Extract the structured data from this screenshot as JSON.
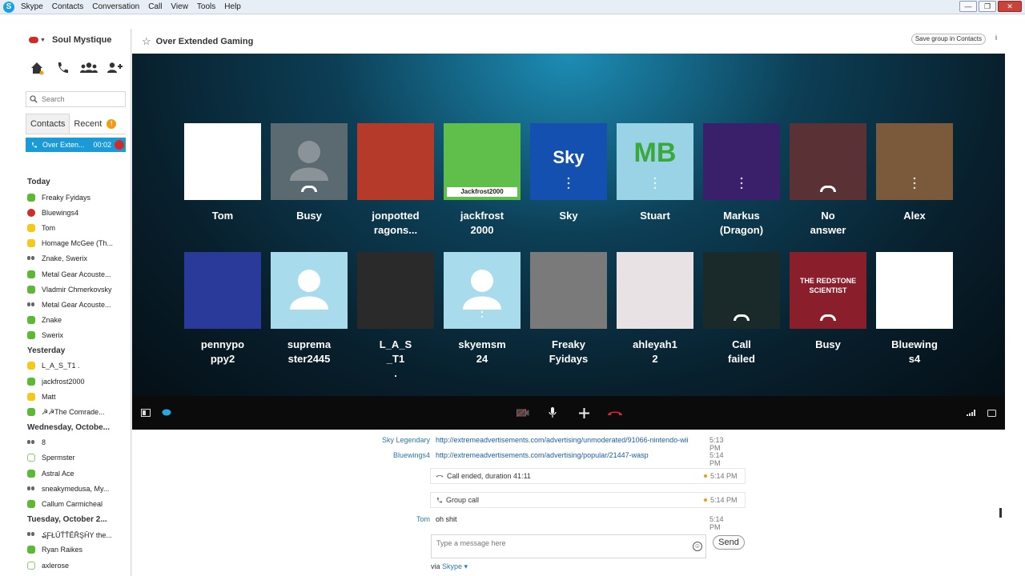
{
  "menu": {
    "items": [
      "Skype",
      "Contacts",
      "Conversation",
      "Call",
      "View",
      "Tools",
      "Help"
    ]
  },
  "window_controls": {
    "minimize": "—",
    "restore": "❐",
    "close": "✕"
  },
  "user": {
    "name": "Soul Mystique",
    "status_color": "#d22a2a"
  },
  "search": {
    "placeholder": "Search"
  },
  "tabs": {
    "contacts": "Contacts",
    "recent": "Recent",
    "recent_badge": "!"
  },
  "active_call": {
    "name": "Over Exten...",
    "time": "00:02"
  },
  "groups": [
    {
      "label": "Today",
      "contacts": [
        {
          "name": "Freaky Fyidays",
          "status": "online"
        },
        {
          "name": "Bluewings4",
          "status": "dnd"
        },
        {
          "name": "Tom",
          "status": "away"
        },
        {
          "name": "Homage McGee (Th...",
          "status": "away"
        },
        {
          "name": "Znake, Swerix",
          "status": "group"
        },
        {
          "name": "Metal Gear Acouste...",
          "status": "online"
        },
        {
          "name": "Vladmir Chmerkovsky",
          "status": "online"
        },
        {
          "name": "Metal Gear Acouste...",
          "status": "group"
        },
        {
          "name": "Znake",
          "status": "online"
        },
        {
          "name": "Swerix",
          "status": "online"
        }
      ]
    },
    {
      "label": "Yesterday",
      "contacts": [
        {
          "name": "L_A_S_T1 .",
          "status": "away"
        },
        {
          "name": "jackfrost2000",
          "status": "online"
        },
        {
          "name": "Matt",
          "status": "away"
        },
        {
          "name": "☭☭The Comrade...",
          "status": "online"
        }
      ]
    },
    {
      "label": "Wednesday, Octobe...",
      "contacts": [
        {
          "name": "8",
          "status": "group"
        },
        {
          "name": "Spermster",
          "status": "offline"
        },
        {
          "name": "Astral Ace",
          "status": "online"
        },
        {
          "name": "sneakymedusa, My...",
          "status": "group"
        },
        {
          "name": "Callum Carmicheal",
          "status": "online"
        }
      ]
    },
    {
      "label": "Tuesday, October 2...",
      "contacts": [
        {
          "name": "₷ƑŁŰŤŤĔŘŞĤY the...",
          "status": "group"
        },
        {
          "name": "Ryan Raikes",
          "status": "online"
        },
        {
          "name": "axlerose",
          "status": "offline"
        }
      ]
    }
  ],
  "conversation": {
    "title": "Over Extended Gaming",
    "save_group": "Save group in Contacts",
    "info": "i"
  },
  "participants": [
    {
      "label": "Tom",
      "bg": "#ffffff",
      "state": "dots"
    },
    {
      "label": "Busy",
      "bg": "#5a6a70",
      "state": "ended",
      "avatar": "generic-dark"
    },
    {
      "label": "jonpotted ragons...",
      "bg": "#b53a2a",
      "state": "none"
    },
    {
      "label": "jackfrost 2000",
      "bg": "#5fbf4a",
      "state": "none",
      "caption": "Jackfrost2000"
    },
    {
      "label": "Sky",
      "bg": "#1450b0",
      "state": "dots",
      "caption": "Sky"
    },
    {
      "label": "Stuart",
      "bg": "#9ad3e6",
      "state": "dots",
      "caption": "MB"
    },
    {
      "label": "Markus (Dragon)",
      "bg": "#3a1f6a",
      "state": "dots"
    },
    {
      "label": "No answer",
      "bg": "#5a3236",
      "state": "ended"
    },
    {
      "label": "Alex",
      "bg": "#7a5a3a",
      "state": "dots"
    },
    {
      "label": "pennypo ppy2",
      "bg": "#2a3a9a",
      "state": "none"
    },
    {
      "label": "suprema ster2445",
      "bg": "#a8dcec",
      "state": "none",
      "avatar": "generic-light"
    },
    {
      "label": "L_A_S _T1 .",
      "bg": "#2a2a2a",
      "state": "none"
    },
    {
      "label": "skyemsm 24",
      "bg": "#a8dcec",
      "state": "dots",
      "avatar": "generic-light"
    },
    {
      "label": "Freaky Fyidays",
      "bg": "#7a7a7a",
      "state": "none"
    },
    {
      "label": "ahleyah1 2",
      "bg": "#e8e2e4",
      "state": "none"
    },
    {
      "label": "Call failed",
      "bg": "#1a2a2a",
      "state": "ended"
    },
    {
      "label": "Busy",
      "bg": "#8a1e2a",
      "state": "ended",
      "caption": "THE REDSTONE SCIENTIST"
    },
    {
      "label": "Bluewing s4",
      "bg": "#ffffff",
      "state": "none"
    }
  ],
  "chat": {
    "messages": [
      {
        "sender": "Sky Legendary",
        "body": "http://extremeadvertisements.com/advertising/unmoderated/91066-nintendo-wii",
        "time": "5:13 PM"
      },
      {
        "sender": "Bluewings4",
        "body": "http://extremeadvertisements.com/advertising/popular/21447-wasp",
        "time": "5:14 PM"
      }
    ],
    "events": [
      {
        "text": "Call ended, duration 41:11",
        "time": "5:14 PM"
      },
      {
        "text": "Group call",
        "time": "5:14 PM"
      }
    ],
    "last_message": {
      "sender": "Tom",
      "body": "oh shit",
      "time": "5:14 PM"
    },
    "input_placeholder": "Type a message here",
    "send_label": "Send",
    "via_label": "via",
    "via_service": "Skype ▾"
  },
  "colors": {
    "accent": "#1a9ad6",
    "online": "#5cb935",
    "away": "#f5c91c",
    "dnd": "#d22a2a",
    "hangup": "#d22a2a"
  }
}
